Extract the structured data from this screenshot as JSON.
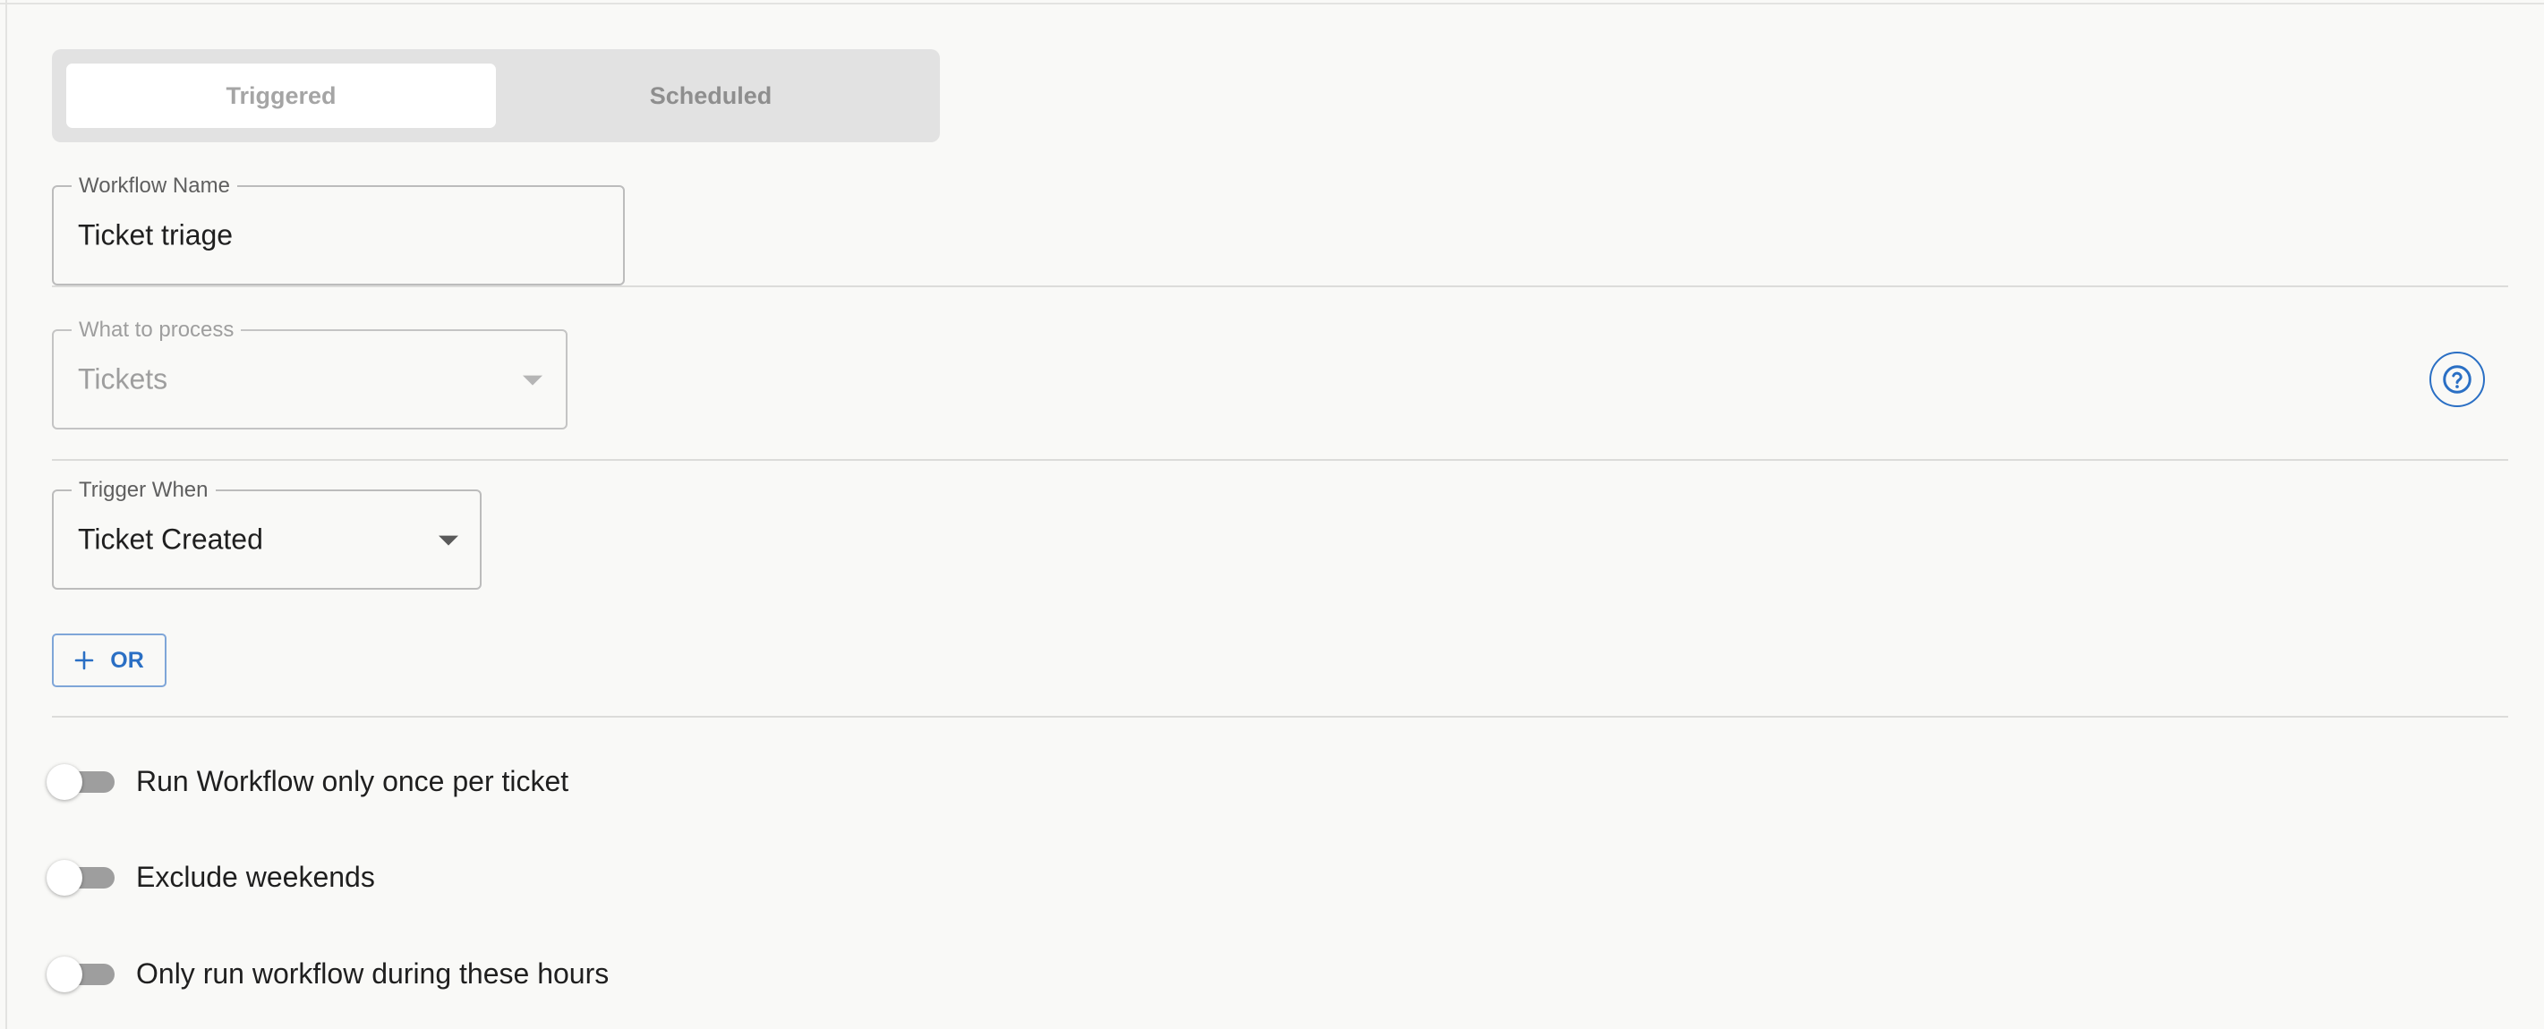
{
  "mode_tabs": [
    {
      "label": "Triggered",
      "selected": true
    },
    {
      "label": "Scheduled",
      "selected": false
    }
  ],
  "workflow_name": {
    "label": "Workflow Name",
    "value": "Ticket triage"
  },
  "what_to_process": {
    "label": "What to process",
    "value": "Tickets",
    "disabled": true
  },
  "help": {
    "icon": "help-circle-icon",
    "color": "#2a6fc4"
  },
  "trigger_when": {
    "label": "Trigger When",
    "value": "Ticket Created"
  },
  "or_button": {
    "label": "OR",
    "icon": "plus-icon"
  },
  "toggles": [
    {
      "label": "Run Workflow only once per ticket",
      "on": false
    },
    {
      "label": "Exclude weekends",
      "on": false
    },
    {
      "label": "Only run workflow during these hours",
      "on": false
    }
  ],
  "colors": {
    "accent": "#2a6fc4",
    "toggle_off_track": "#9e9e9e",
    "background": "#f9f9f7"
  }
}
